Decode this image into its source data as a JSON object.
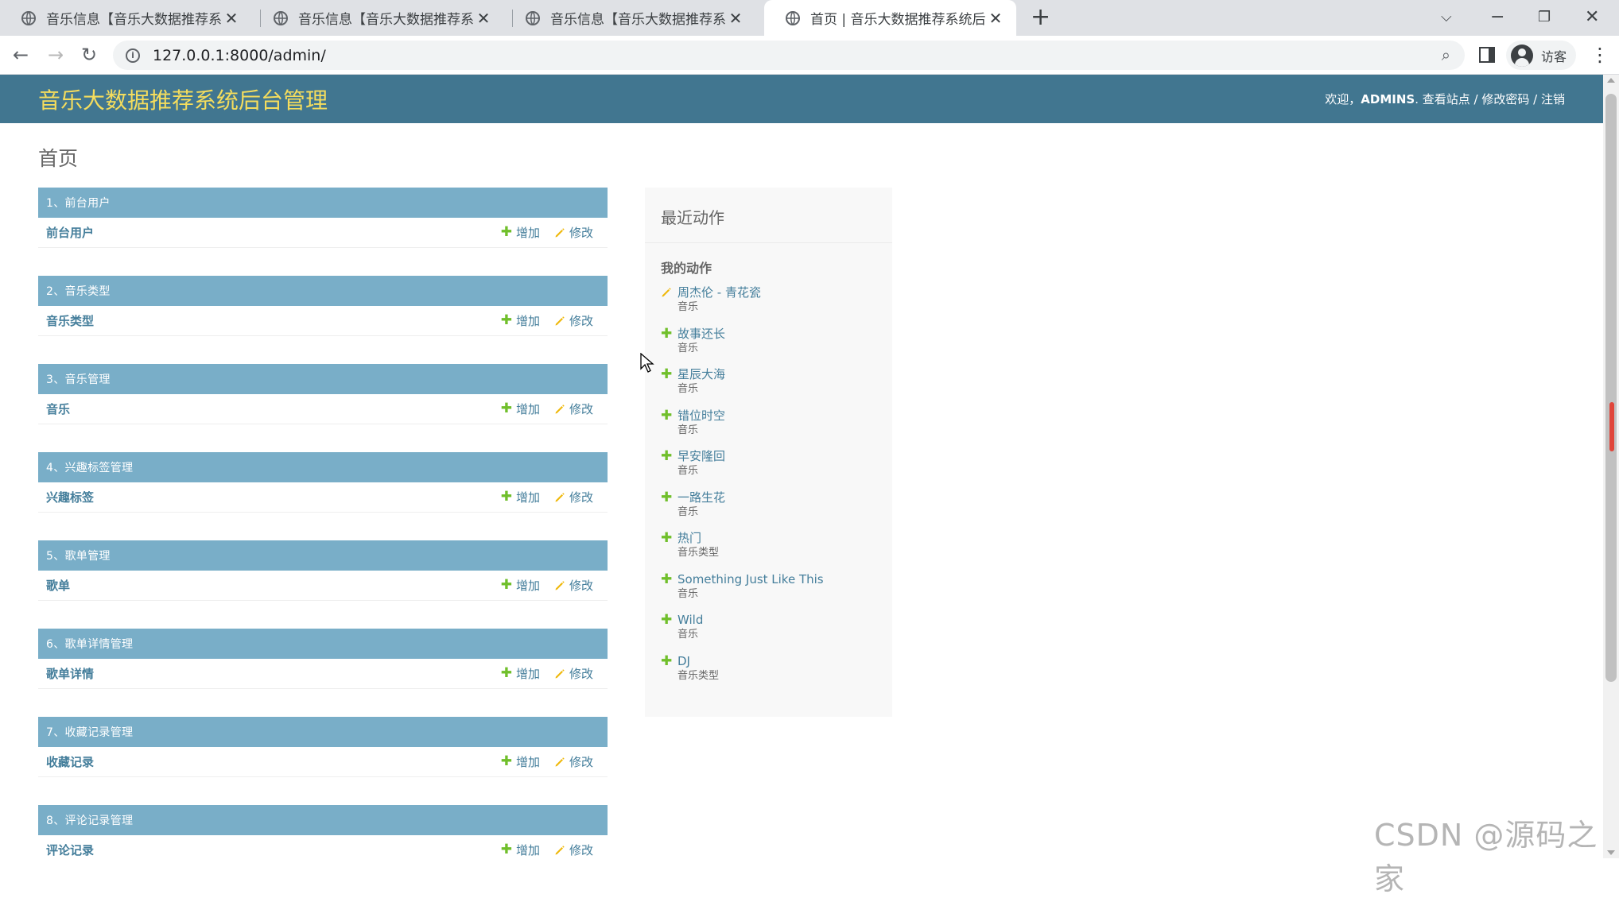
{
  "browser": {
    "tabs": [
      {
        "title": "音乐信息【音乐大数据推荐系统】",
        "active": false
      },
      {
        "title": "音乐信息【音乐大数据推荐系统】",
        "active": false
      },
      {
        "title": "音乐信息【音乐大数据推荐系统】",
        "active": false
      },
      {
        "title": "首页 | 音乐大数据推荐系统后台管",
        "active": true
      }
    ],
    "url": "127.0.0.1:8000/admin/",
    "profile_label": "访客"
  },
  "header": {
    "branding": "音乐大数据推荐系统后台管理",
    "welcome": "欢迎，",
    "username": "ADMINS",
    "period": ".",
    "view_site": "查看站点",
    "change_password": "修改密码",
    "logout": "注销",
    "sep": " / "
  },
  "page_title": "首页",
  "actions": {
    "add": "增加",
    "change": "修改"
  },
  "modules": [
    {
      "caption": "1、前台用户",
      "model": "前台用户"
    },
    {
      "caption": "2、音乐类型",
      "model": "音乐类型"
    },
    {
      "caption": "3、音乐管理",
      "model": "音乐"
    },
    {
      "caption": "4、兴趣标签管理",
      "model": "兴趣标签"
    },
    {
      "caption": "5、歌单管理",
      "model": "歌单"
    },
    {
      "caption": "6、歌单详情管理",
      "model": "歌单详情"
    },
    {
      "caption": "7、收藏记录管理",
      "model": "收藏记录"
    },
    {
      "caption": "8、评论记录管理",
      "model": "评论记录"
    }
  ],
  "recent": {
    "title": "最近动作",
    "subtitle": "我的动作",
    "items": [
      {
        "icon": "pencil-icon",
        "object": "周杰伦 - 青花瓷",
        "type": "音乐"
      },
      {
        "icon": "plus-icon",
        "object": "故事还长",
        "type": "音乐"
      },
      {
        "icon": "plus-icon",
        "object": "星辰大海",
        "type": "音乐"
      },
      {
        "icon": "plus-icon",
        "object": "错位时空",
        "type": "音乐"
      },
      {
        "icon": "plus-icon",
        "object": "早安隆回",
        "type": "音乐"
      },
      {
        "icon": "plus-icon",
        "object": "一路生花",
        "type": "音乐"
      },
      {
        "icon": "plus-icon",
        "object": "热门",
        "type": "音乐类型"
      },
      {
        "icon": "plus-icon",
        "object": "Something Just Like This",
        "type": "音乐"
      },
      {
        "icon": "plus-icon",
        "object": "Wild",
        "type": "音乐"
      },
      {
        "icon": "plus-icon",
        "object": "DJ",
        "type": "音乐类型"
      }
    ]
  },
  "watermark": "CSDN @源码之家",
  "colors": {
    "header_bg": "#417690",
    "branding": "#f5dd5d",
    "caption_bg": "#79aec8",
    "link": "#447e9b",
    "add_icon": "#70bf2b",
    "change_icon": "#efb80b"
  }
}
